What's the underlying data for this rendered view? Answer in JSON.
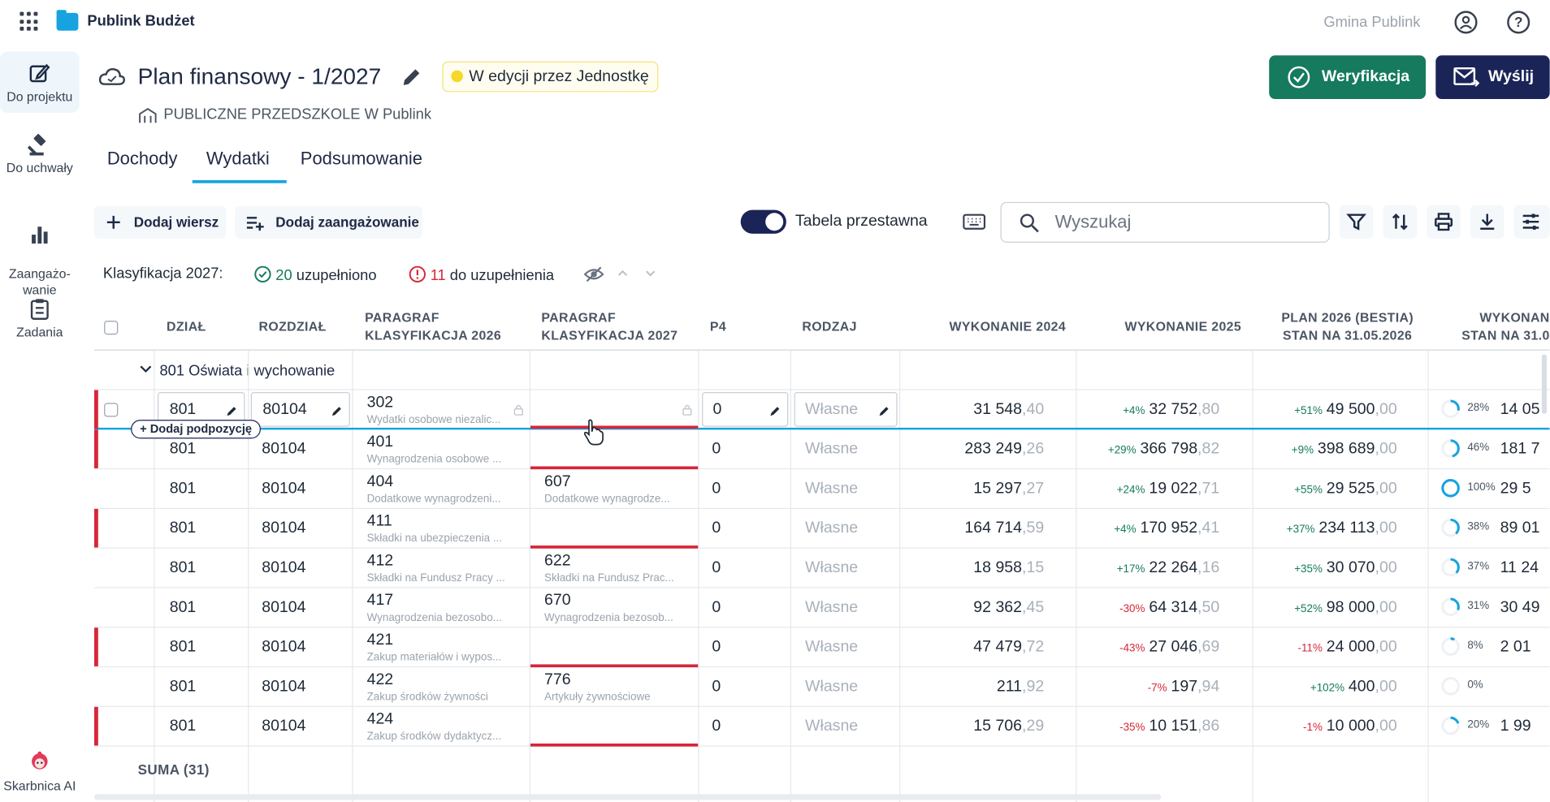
{
  "app": {
    "name": "Publink Budżet",
    "org": "Gmina Publink"
  },
  "sidebar": {
    "items": [
      {
        "label": "Do projektu",
        "icon": "edit-icon"
      },
      {
        "label": "Do uchwały",
        "icon": "gavel-icon"
      },
      {
        "label": "Zaangażo-\nwanie",
        "icon": "bar-chart-icon"
      },
      {
        "label": "Zadania",
        "icon": "clipboard-icon"
      },
      {
        "label": "Skarbnica AI",
        "icon": "assistant-avatar-icon"
      }
    ]
  },
  "header": {
    "title": "Plan finansowy - 1/2027",
    "status": "W edycji przez Jednostkę",
    "unit": "PUBLICZNE PRZEDSZKOLE W Publink",
    "verify_label": "Weryfikacja",
    "send_label": "Wyślij"
  },
  "tabs": [
    "Dochody",
    "Wydatki",
    "Podsumowanie"
  ],
  "active_tab": "Wydatki",
  "toolbar": {
    "add_row": "Dodaj wiersz",
    "add_commitment": "Dodaj zaangażowanie",
    "toggle_label": "Tabela przestawna",
    "toggle_on": true,
    "search_placeholder": "Wyszukaj"
  },
  "classification": {
    "label": "Klasyfikacja 2027:",
    "filled_count": "20",
    "filled_text": "uzupełniono",
    "todo_count": "11",
    "todo_text": "do uzupełnienia"
  },
  "table": {
    "columns": {
      "dzial": "DZIAŁ",
      "rozdzial": "ROZDZIAŁ",
      "para2026": "PARAGRAF\nKLASYFIKACJA 2026",
      "para2027": "PARAGRAF\nKLASYFIKACJA 2027",
      "p4": "P4",
      "rodzaj": "RODZAJ",
      "wyk2024": "WYKONANIE 2024",
      "wyk2025": "WYKONANIE 2025",
      "plan2026": "PLAN 2026 (BESTIA)\nSTAN NA 31.05.2026",
      "wyk2026": "WYKONAN\nSTAN NA 31.0"
    },
    "group": "801 Oświata i wychowanie",
    "add_subposition": "Dodaj podpozycję",
    "rows": [
      {
        "dzial": "801",
        "rozdzial": "80104",
        "p26_code": "302",
        "p26_desc": "Wydatki osobowe niezalic...",
        "p27_code": "",
        "p27_desc": "",
        "p4": "0",
        "rodzaj": "Własne",
        "w24_int": "31 548",
        "w24_dec": ",40",
        "w25_pct": "+4%",
        "w25_int": "32 752",
        "w25_dec": ",80",
        "pl_pct": "+51%",
        "pl_int": "49 500",
        "pl_dec": ",00",
        "done_pct": "28%",
        "done_val": "14 05"
      },
      {
        "dzial": "801",
        "rozdzial": "80104",
        "p26_code": "401",
        "p26_desc": "Wynagrodzenia osobowe ...",
        "p27_code": "",
        "p27_desc": "",
        "p4": "0",
        "rodzaj": "Własne",
        "w24_int": "283 249",
        "w24_dec": ",26",
        "w25_pct": "+29%",
        "w25_int": "366 798",
        "w25_dec": ",82",
        "pl_pct": "+9%",
        "pl_int": "398 689",
        "pl_dec": ",00",
        "done_pct": "46%",
        "done_val": "181 7"
      },
      {
        "dzial": "801",
        "rozdzial": "80104",
        "p26_code": "404",
        "p26_desc": "Dodatkowe wynagrodzeni...",
        "p27_code": "607",
        "p27_desc": "Dodatkowe wynagrodze...",
        "p4": "0",
        "rodzaj": "Własne",
        "w24_int": "15 297",
        "w24_dec": ",27",
        "w25_pct": "+24%",
        "w25_int": "19 022",
        "w25_dec": ",71",
        "pl_pct": "+55%",
        "pl_int": "29 525",
        "pl_dec": ",00",
        "done_pct": "100%",
        "done_val": "29 5"
      },
      {
        "dzial": "801",
        "rozdzial": "80104",
        "p26_code": "411",
        "p26_desc": "Składki na ubezpieczenia ...",
        "p27_code": "",
        "p27_desc": "",
        "p4": "0",
        "rodzaj": "Własne",
        "w24_int": "164 714",
        "w24_dec": ",59",
        "w25_pct": "+4%",
        "w25_int": "170 952",
        "w25_dec": ",41",
        "pl_pct": "+37%",
        "pl_int": "234 113",
        "pl_dec": ",00",
        "done_pct": "38%",
        "done_val": "89 01"
      },
      {
        "dzial": "801",
        "rozdzial": "80104",
        "p26_code": "412",
        "p26_desc": "Składki na Fundusz Pracy ...",
        "p27_code": "622",
        "p27_desc": "Składki na Fundusz Prac...",
        "p4": "0",
        "rodzaj": "Własne",
        "w24_int": "18 958",
        "w24_dec": ",15",
        "w25_pct": "+17%",
        "w25_int": "22 264",
        "w25_dec": ",16",
        "pl_pct": "+35%",
        "pl_int": "30 070",
        "pl_dec": ",00",
        "done_pct": "37%",
        "done_val": "11 24"
      },
      {
        "dzial": "801",
        "rozdzial": "80104",
        "p26_code": "417",
        "p26_desc": "Wynagrodzenia bezosobo...",
        "p27_code": "670",
        "p27_desc": "Wynagrodzenia bezosob...",
        "p4": "0",
        "rodzaj": "Własne",
        "w24_int": "92 362",
        "w24_dec": ",45",
        "w25_pct": "-30%",
        "w25_int": "64 314",
        "w25_dec": ",50",
        "pl_pct": "+52%",
        "pl_int": "98 000",
        "pl_dec": ",00",
        "done_pct": "31%",
        "done_val": "30 49"
      },
      {
        "dzial": "801",
        "rozdzial": "80104",
        "p26_code": "421",
        "p26_desc": "Zakup materiałów i wypos...",
        "p27_code": "",
        "p27_desc": "",
        "p4": "0",
        "rodzaj": "Własne",
        "w24_int": "47 479",
        "w24_dec": ",72",
        "w25_pct": "-43%",
        "w25_int": "27 046",
        "w25_dec": ",69",
        "pl_pct": "-11%",
        "pl_int": "24 000",
        "pl_dec": ",00",
        "done_pct": "8%",
        "done_val": "2 01"
      },
      {
        "dzial": "801",
        "rozdzial": "80104",
        "p26_code": "422",
        "p26_desc": "Zakup środków żywności",
        "p27_code": "776",
        "p27_desc": "Artykuły żywnościowe",
        "p4": "0",
        "rodzaj": "Własne",
        "w24_int": "211",
        "w24_dec": ",92",
        "w25_pct": "-7%",
        "w25_int": "197",
        "w25_dec": ",94",
        "pl_pct": "+102%",
        "pl_int": "400",
        "pl_dec": ",00",
        "done_pct": "0%",
        "done_val": ""
      },
      {
        "dzial": "801",
        "rozdzial": "80104",
        "p26_code": "424",
        "p26_desc": "Zakup środków dydaktycz...",
        "p27_code": "",
        "p27_desc": "",
        "p4": "0",
        "rodzaj": "Własne",
        "w24_int": "15 706",
        "w24_dec": ",29",
        "w25_pct": "-35%",
        "w25_int": "10 151",
        "w25_dec": ",86",
        "pl_pct": "-1%",
        "pl_int": "10 000",
        "pl_dec": ",00",
        "done_pct": "20%",
        "done_val": "1 99"
      }
    ],
    "sum_label": "SUMA (31)"
  },
  "colors": {
    "primary": "#1b2457",
    "success": "#157a5e",
    "accent": "#16a3e0",
    "error": "#d72638",
    "status": "#f5d82b"
  }
}
